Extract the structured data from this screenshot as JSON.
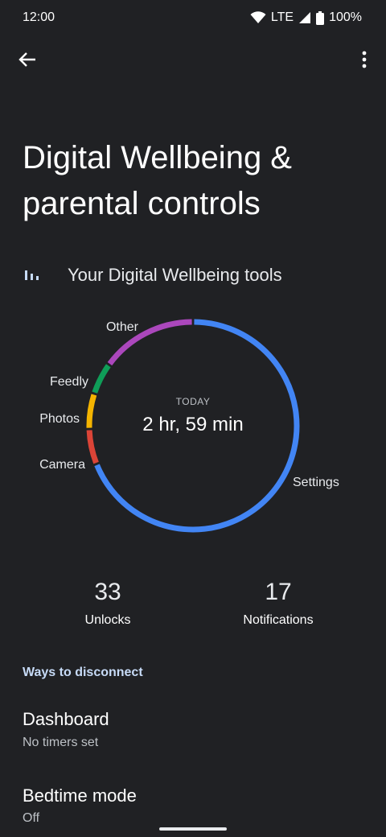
{
  "status_bar": {
    "time": "12:00",
    "network": "LTE",
    "battery": "100%",
    "icons": [
      "wifi-icon",
      "cell-signal-icon",
      "battery-icon"
    ]
  },
  "app_bar": {
    "back_icon": "arrow-back-icon",
    "more_icon": "more-vert-icon"
  },
  "page": {
    "title": "Digital Wellbeing & parental controls"
  },
  "tools": {
    "icon": "bar-chart-icon",
    "label": "Your Digital Wellbeing tools"
  },
  "chart_data": {
    "type": "pie",
    "center_caption": "TODAY",
    "center_value": "2 hr, 59 min",
    "slices": [
      {
        "label": "Settings",
        "color": "#4285f4",
        "share": 0.69
      },
      {
        "label": "Camera",
        "color": "#db4437",
        "share": 0.055
      },
      {
        "label": "Photos",
        "color": "#f4b400",
        "share": 0.055
      },
      {
        "label": "Feedly",
        "color": "#0f9d58",
        "share": 0.05
      },
      {
        "label": "Other",
        "color": "#ab47bc",
        "share": 0.15
      }
    ]
  },
  "stats": {
    "unlocks_value": "33",
    "unlocks_label": "Unlocks",
    "notifications_value": "17",
    "notifications_label": "Notifications"
  },
  "section": {
    "header": "Ways to disconnect"
  },
  "list": [
    {
      "title": "Dashboard",
      "subtitle": "No timers set"
    },
    {
      "title": "Bedtime mode",
      "subtitle": "Off"
    }
  ],
  "colors": {
    "background": "#202124",
    "accent_header": "#c7dbf7"
  }
}
